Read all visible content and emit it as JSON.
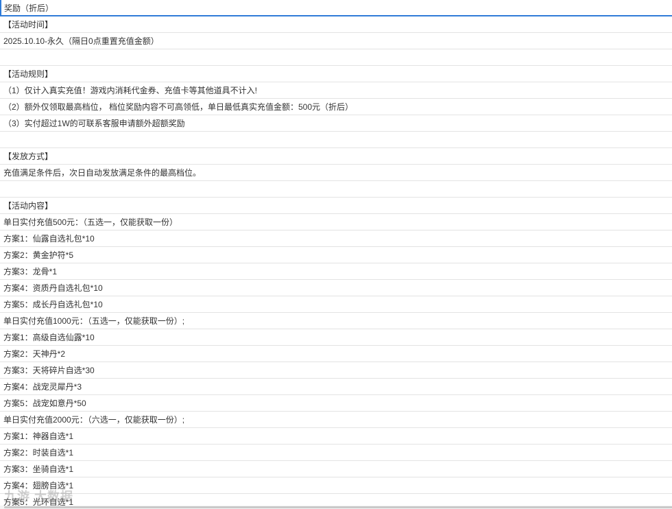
{
  "header": {
    "cell": "奖励（折后）"
  },
  "rows": [
    "【活动时间】",
    "2025.10.10-永久（隔日0点重置充值金额）",
    "",
    "【活动规则】",
    "（1）仅计入真实充值！游戏内消耗代金券、充值卡等其他道具不计入!",
    "（2）额外仅领取最高档位， 档位奖励内容不可高领低，单日最低真实充值金额：500元（折后）",
    "（3）实付超过1W的可联系客服申请额外超额奖励",
    "",
    "【发放方式】",
    "充值满足条件后，次日自动发放满足条件的最高档位。",
    "",
    "【活动内容】",
    "单日实付充值500元：（五选一，仅能获取一份）",
    "方案1：仙露自选礼包*10",
    "方案2：黄金护符*5",
    "方案3：龙骨*1",
    "方案4：资质丹自选礼包*10",
    "方案5：成长丹自选礼包*10",
    "单日实付充值1000元：（五选一，仅能获取一份）;",
    "方案1：高级自选仙露*10",
    "方案2：天神丹*2",
    "方案3：天将碎片自选*30",
    "方案4：战宠灵犀丹*3",
    "方案5：战宠如意丹*50",
    "单日实付充值2000元：（六选一，仅能获取一份）;",
    "方案1：神器自选*1",
    "方案2：时装自选*1",
    "方案3：坐骑自选*1",
    "方案4：翅膀自选*1",
    "方案5：光环自选*1"
  ],
  "watermark": "九游 大数据"
}
